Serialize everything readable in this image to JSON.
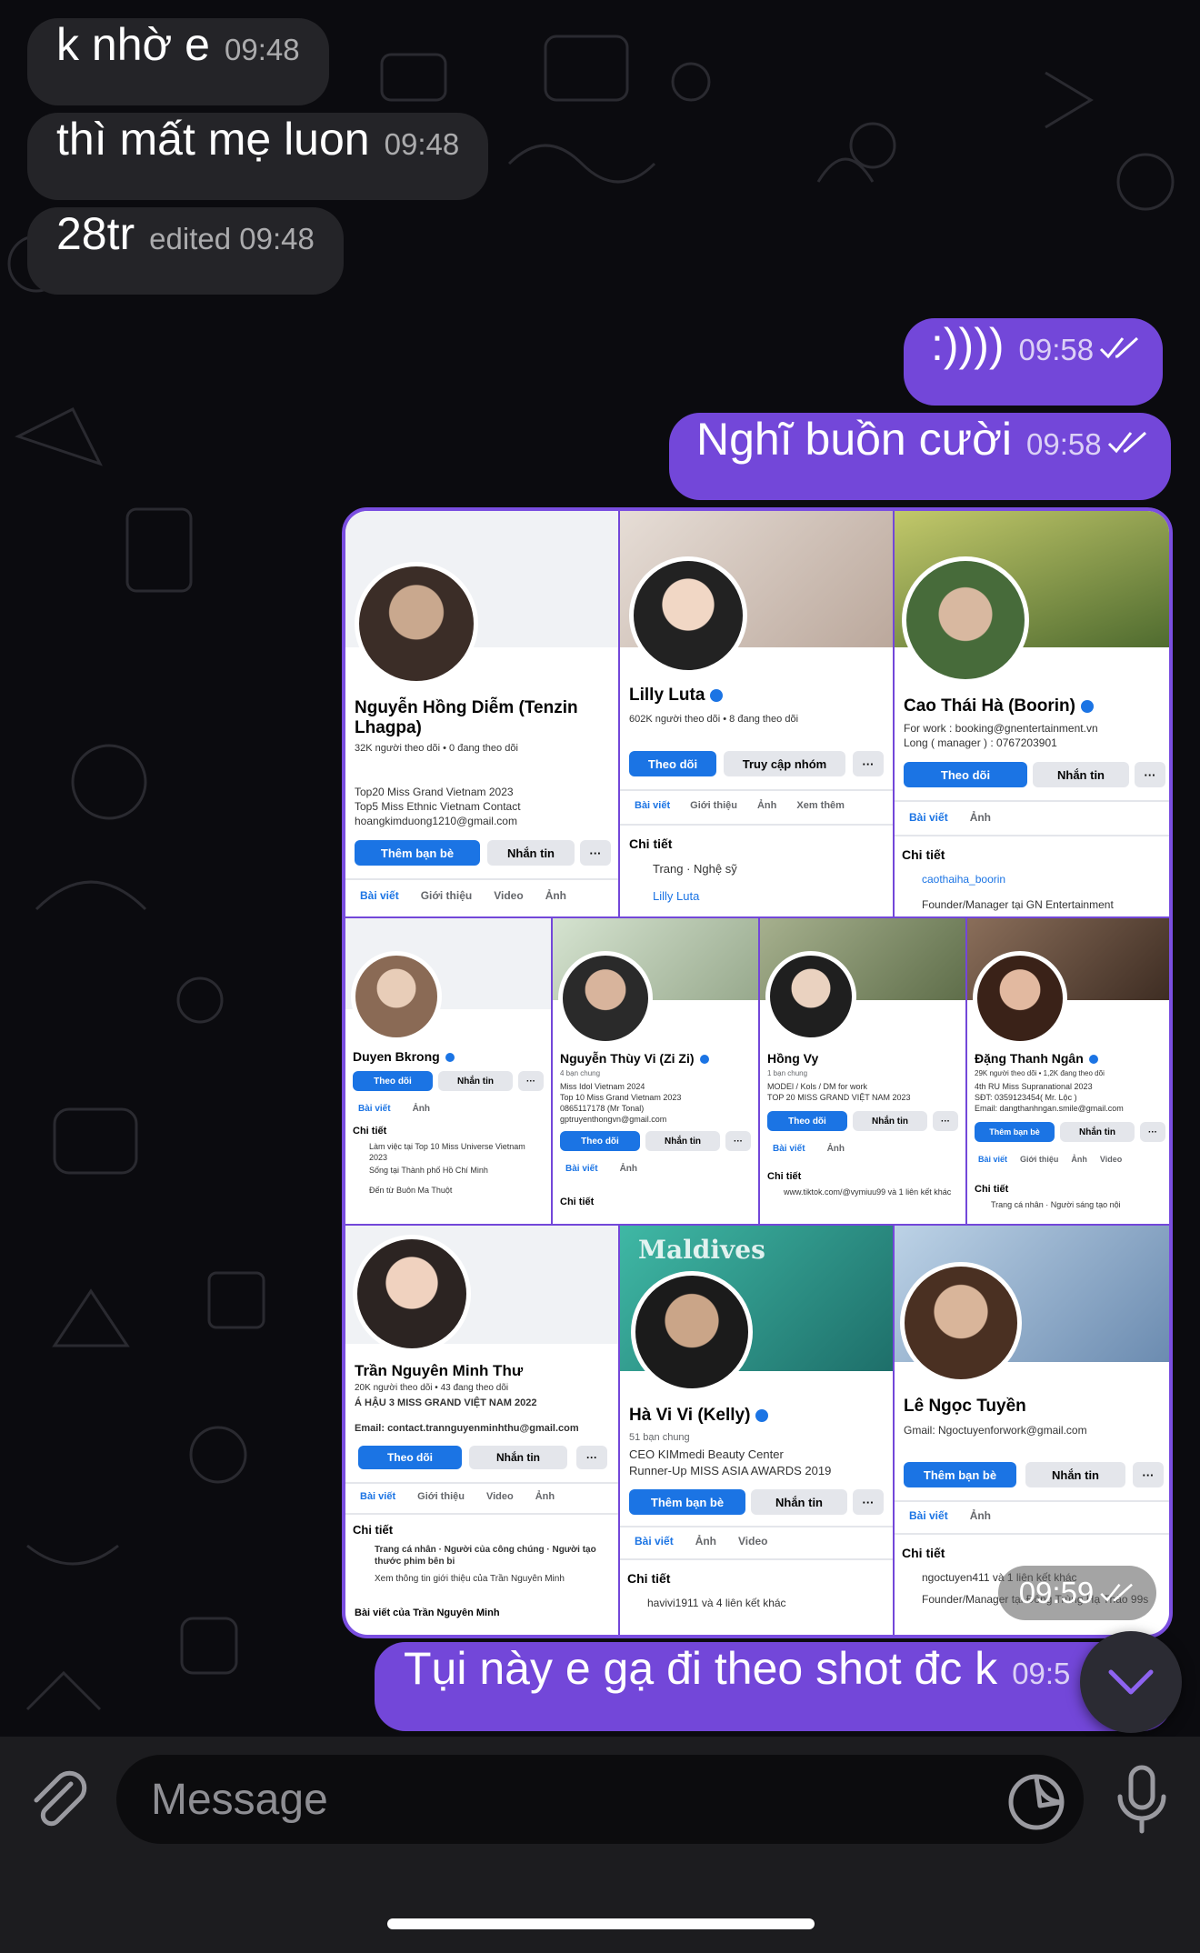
{
  "messages": [
    {
      "text": "k nhờ e",
      "meta": "09:48"
    },
    {
      "text": "thì mất mẹ luon",
      "meta": "09:48"
    },
    {
      "text": "28tr",
      "meta": "edited 09:48"
    },
    {
      "text": ":))))",
      "meta": "09:58"
    },
    {
      "text": "Nghĩ buồn cười",
      "meta": "09:58"
    },
    {
      "text": "Tụi này e gạ đi theo shot đc k",
      "meta": "09:5"
    }
  ],
  "collage_time": "09:59",
  "input": {
    "placeholder": "Message"
  },
  "cards": {
    "c1": {
      "name": "Nguyễn Hồng Diễm (Tenzin Lhagpa)",
      "stats": "32K người theo dõi • 0 đang theo dõi",
      "bio": [
        "Top20 Miss Grand Vietnam 2023",
        "Top5 Miss Ethnic Vietnam Contact",
        "hoangkimduong1210@gmail.com"
      ],
      "btn1": "Thêm bạn bè",
      "btn2": "Nhắn tin",
      "tabs": [
        "Bài viết",
        "Giới thiệu",
        "Video",
        "Ảnh"
      ]
    },
    "c2": {
      "name": "Lilly Luta",
      "stats": "602K người theo dõi • 8 đang theo dõi",
      "btn1": "Theo dõi",
      "btn2": "Truy cập nhóm",
      "tabs": [
        "Bài viết",
        "Giới thiệu",
        "Ảnh",
        "Xem thêm"
      ],
      "detail_title": "Chi tiết",
      "detail1": "Trang · Nghệ sỹ",
      "detail2": "Lilly Luta"
    },
    "c3": {
      "name": "Cao Thái Hà (Boorin)",
      "bio1": "For work : booking@gnentertainment.vn",
      "bio2": "Long ( manager ) : 0767203901",
      "btn1": "Theo dõi",
      "btn2": "Nhắn tin",
      "tabs": [
        "Bài viết",
        "Ảnh"
      ],
      "detail_title": "Chi tiết",
      "detail1": "caothaiha_boorin",
      "detail2": "Founder/Manager tại GN Entertainment"
    },
    "c4": {
      "name": "Duyen Bkrong",
      "btn1": "Theo dõi",
      "btn2": "Nhắn tin",
      "tabs": [
        "Bài viết",
        "Ảnh"
      ],
      "detail_title": "Chi tiết",
      "detail1": "Làm việc tại Top 10 Miss Universe Vietnam 2023",
      "detail2": "Sống tại Thành phố Hồ Chí Minh",
      "detail3": "Đến từ Buôn Ma Thuột"
    },
    "c5": {
      "name": "Nguyễn Thùy Vi (Zi Zi)",
      "sub": "4 bạn chung",
      "bio": [
        "Miss Idol Vietnam 2024",
        "Top 10 Miss Grand Vietnam 2023",
        "0865117178 (Mr Tonal)",
        "gptruyenthongvn@gmail.com"
      ],
      "btn1": "Theo dõi",
      "btn2": "Nhắn tin",
      "tabs": [
        "Bài viết",
        "Ảnh"
      ],
      "detail_title": "Chi tiết"
    },
    "c6": {
      "name": "Hồng Vy",
      "sub": "1 bạn chung",
      "bio": [
        "MODEl / Kols / DM for work",
        "TOP 20 MISS GRAND VIỆT NAM 2023"
      ],
      "btn1": "Theo dõi",
      "btn2": "Nhắn tin",
      "tabs": [
        "Bài viết",
        "Ảnh"
      ],
      "detail_title": "Chi tiết",
      "detail1": "www.tiktok.com/@vymiuu99 và 1 liên kết khác"
    },
    "c7": {
      "name": "Đặng Thanh Ngân",
      "sub": "29K người theo dõi • 1,2K đang theo dõi",
      "bio": [
        "4th RU Miss Supranational 2023",
        "SĐT: 0359123454( Mr. Lộc )",
        "Email: dangthanhngan.smile@gmail.com"
      ],
      "btn1": "Thêm bạn bè",
      "btn2": "Nhắn tin",
      "tabs": [
        "Bài viết",
        "Giới thiệu",
        "Ảnh",
        "Video"
      ],
      "detail_title": "Chi tiết",
      "detail1": "Trang cá nhân · Người sáng tạo nội"
    },
    "c8": {
      "name": "Trần Nguyên Minh Thư",
      "sub": "20K người theo dõi • 43 đang theo dõi",
      "bio1": "Á HẬU 3 MISS GRAND VIỆT NAM 2022",
      "email": "Email: contact.trannguyenminhthu@gmail.com",
      "btn1": "Theo dõi",
      "btn2": "Nhắn tin",
      "tabs": [
        "Bài viết",
        "Giới thiệu",
        "Video",
        "Ảnh"
      ],
      "detail_title": "Chi tiết",
      "detail1": "Trang cá nhân · Người của công chúng · Người tạo thước phim bên bi",
      "detail2": "Xem thông tin giới thiệu của Trần Nguyên Minh",
      "detail3": "Bài viết của Trần Nguyên Minh"
    },
    "c9": {
      "name": "Hà Vi Vi (Kelly)",
      "sub": "51 bạn chung",
      "bio": [
        "CEO KIMmedi Beauty Center",
        "Runner-Up MISS ASIA AWARDS 2019"
      ],
      "btn1": "Thêm bạn bè",
      "btn2": "Nhắn tin",
      "tabs": [
        "Bài viết",
        "Ảnh",
        "Video"
      ],
      "detail_title": "Chi tiết",
      "detail1": "havivi1911 và 4 liên kết khác",
      "cover_text": "Maldives"
    },
    "c10": {
      "name": "Lê Ngọc Tuyền",
      "bio1": "Gmail:  Ngoctuyenforwork@gmail.com",
      "btn1": "Thêm bạn bè",
      "btn2": "Nhắn tin",
      "tabs": [
        "Bài viết",
        "Ảnh"
      ],
      "detail_title": "Chi tiết",
      "detail1": "ngoctuyen411 và 1 liên kết khác",
      "detail2": "Founder/Manager tại Đông Trùng Hạ Thảo 99s"
    }
  }
}
